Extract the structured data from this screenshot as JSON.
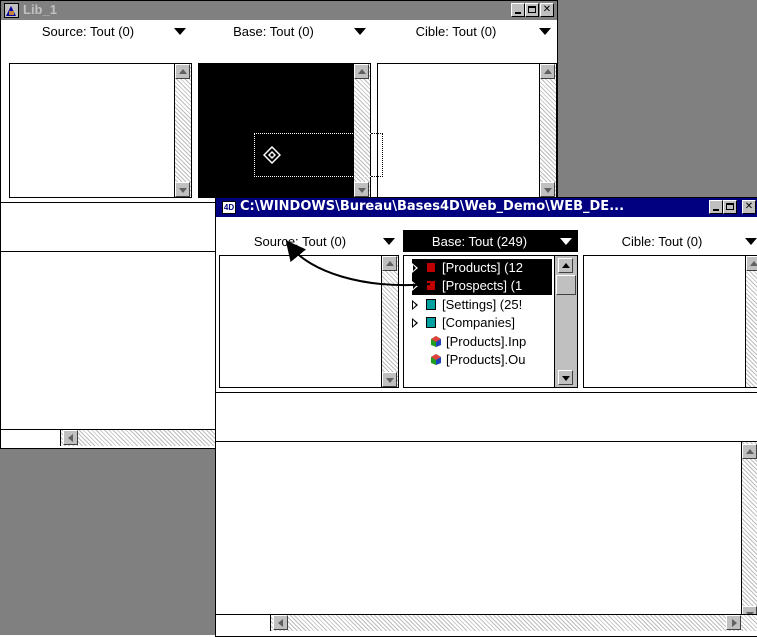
{
  "window1": {
    "title": "Lib_1",
    "source_header": "Source: Tout (0)",
    "base_header": "Base: Tout (0)",
    "target_header": "Cible: Tout (0)"
  },
  "window2": {
    "title": "C:\\WINDOWS\\Bureau\\Bases4D\\Web_Demo\\WEB_DE...",
    "source_header": "Source: Tout (0)",
    "base_header": "Base: Tout (249)",
    "target_header": "Cible: Tout (0)",
    "base_items": [
      {
        "label": "[Products] (12",
        "kind": "table",
        "selected": true
      },
      {
        "label": "[Prospects] (1",
        "kind": "table",
        "selected": true
      },
      {
        "label": "[Settings] (25!",
        "kind": "table",
        "selected": false
      },
      {
        "label": "[Companies]",
        "kind": "table",
        "selected": false
      },
      {
        "label": "[Products].Inp",
        "kind": "method",
        "selected": false
      },
      {
        "label": "[Products].Ou",
        "kind": "method",
        "selected": false
      }
    ]
  },
  "colors": {
    "desktop": "#808080",
    "titlebar_active": "#000080",
    "titlebar_inactive": "#808080",
    "selection": "#000000",
    "table_icon_red": "#c00000",
    "table_icon_teal": "#00a0a0"
  }
}
